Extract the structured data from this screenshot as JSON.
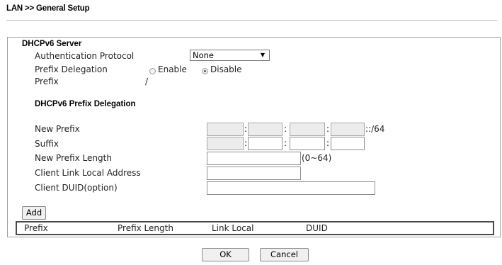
{
  "breadcrumb": "LAN >> General Setup",
  "server": {
    "heading": "DHCPv6 Server",
    "auth_label": "Authentication Protocol",
    "auth_value": "None",
    "pd_label": "Prefix Delegation",
    "enable_label": "Enable",
    "disable_label": "Disable",
    "pd_selected": "Disable",
    "prefix_label": "Prefix",
    "prefix_value": "/"
  },
  "delegation": {
    "heading": "DHCPv6 Prefix Delegation",
    "new_prefix_label": "New Prefix",
    "new_prefix_suffix": "::/64",
    "suffix_label": "Suffix",
    "new_prefix_length_label": "New Prefix Length",
    "length_range": "(0~64)",
    "client_link_local_label": "Client Link Local Address",
    "client_duid_label": "Client DUID(option)",
    "colon": ":"
  },
  "add_button": "Add",
  "table": {
    "columns": [
      "Prefix",
      "Prefix Length",
      "Link Local",
      "DUID"
    ]
  },
  "footer": {
    "ok": "OK",
    "cancel": "Cancel"
  }
}
